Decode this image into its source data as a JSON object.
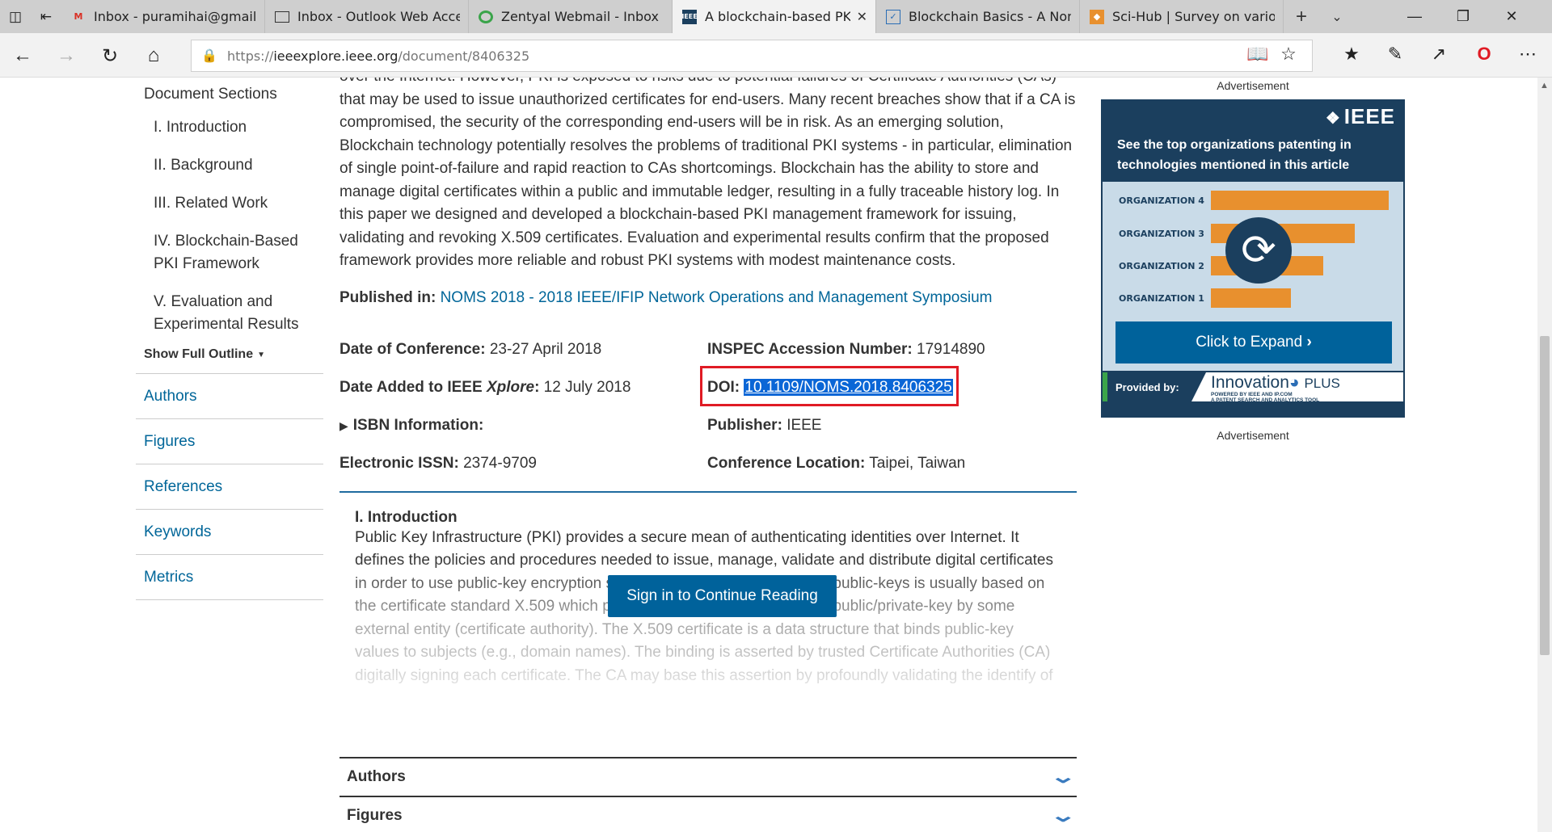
{
  "browser": {
    "tabs": [
      {
        "title": "Inbox - puramihai@gmail.co",
        "favicon": "gmail-icon",
        "active": false
      },
      {
        "title": "Inbox - Outlook Web Acces",
        "favicon": "page-icon",
        "active": false
      },
      {
        "title": "Zentyal Webmail - Inbox",
        "favicon": "zentyal-icon",
        "active": false
      },
      {
        "title": "A blockchain-based PKI",
        "favicon": "ieee-icon",
        "active": true
      },
      {
        "title": "Blockchain Basics - A Non-T",
        "favicon": "book-icon",
        "active": false
      },
      {
        "title": "Sci-Hub | Survey on various",
        "favicon": "scihub-icon",
        "active": false
      }
    ],
    "url_prefix": "https://",
    "url_host": "ieeexplore.ieee.org",
    "url_path": "/document/8406325"
  },
  "sidebar": {
    "title": "Document Sections",
    "sections": [
      "I. Introduction",
      "II. Background",
      "III. Related Work",
      "IV. Blockchain-Based PKI Framework",
      "V. Evaluation and Experimental Results"
    ],
    "show_outline": "Show Full Outline",
    "links": [
      "Authors",
      "Figures",
      "References",
      "Keywords",
      "Metrics"
    ]
  },
  "main": {
    "abstract": "over the Internet. However, PKI is exposed to risks due to potential failures of Certificate Authorities (CAs) that may be used to issue unauthorized certificates for end-users. Many recent breaches show that if a CA is compromised, the security of the corresponding end-users will be in risk. As an emerging solution, Blockchain technology potentially resolves the problems of traditional PKI systems - in particular, elimination of single point-of-failure and rapid reaction to CAs shortcomings. Blockchain has the ability to store and manage digital certificates within a public and immutable ledger, resulting in a fully traceable history log. In this paper we designed and developed a blockchain-based PKI management framework for issuing, validating and revoking X.509 certificates. Evaluation and experimental results confirm that the proposed framework provides more reliable and robust PKI systems with modest maintenance costs.",
    "published_label": "Published in:",
    "published_value": "NOMS 2018 - 2018 IEEE/IFIP Network Operations and Management Symposium",
    "date_conf_label": "Date of Conference:",
    "date_conf_value": "23-27 April 2018",
    "date_added_label": "Date Added to IEEE ",
    "date_added_xplore": "Xplore",
    "date_added_colon": ":",
    "date_added_value": "12 July 2018",
    "isbn_label": "ISBN Information:",
    "issn_label": "Electronic ISSN:",
    "issn_value": "2374-9709",
    "inspec_label": "INSPEC Accession Number:",
    "inspec_value": "17914890",
    "doi_label": "DOI:",
    "doi_value": "10.1109/NOMS.2018.8406325",
    "publisher_label": "Publisher:",
    "publisher_value": "IEEE",
    "location_label": "Conference Location:",
    "location_value": "Taipei, Taiwan",
    "intro_heading": "I. Introduction",
    "intro_text": "Public Key Infrastructure (PKI) provides a secure mean of authenticating identities over Internet. It defines the policies and procedures needed to issue, manage, validate and distribute digital certificates in order to use public-key encryption securely [1]. PKI management of public-keys is usually based on the certificate standard X.509 which provides a binding of identity with public/private-key by some external entity (certificate authority). The X.509 certificate is a data structure that binds public-key values to subjects (e.g., domain names). The binding is asserted by trusted Certificate Authorities (CA) digitally signing each certificate. The CA may base this assertion by profoundly validating the identify of",
    "signin_label": "Sign in to Continue Reading",
    "accordions": [
      "Authors",
      "Figures"
    ]
  },
  "ad": {
    "label_top": "Advertisement",
    "label_bottom": "Advertisement",
    "brand": "IEEE",
    "headline": "See the top organizations patenting in technologies mentioned in this article",
    "orgs": [
      "ORGANIZATION 4",
      "ORGANIZATION 3",
      "ORGANIZATION 2",
      "ORGANIZATION 1"
    ],
    "org_levels": [
      1.0,
      0.81,
      0.63,
      0.45
    ],
    "expand_label": "Click to Expand",
    "provided_by": "Provided by:",
    "partner_name": "Innovation",
    "partner_plus": "PLUS",
    "partner_sub1": "POWERED BY IEEE AND IP.COM",
    "partner_sub2": "A PATENT SEARCH AND ANALYTICS TOOL",
    "bar_color": "#e8902e",
    "brand_color": "#1b3f5e"
  }
}
